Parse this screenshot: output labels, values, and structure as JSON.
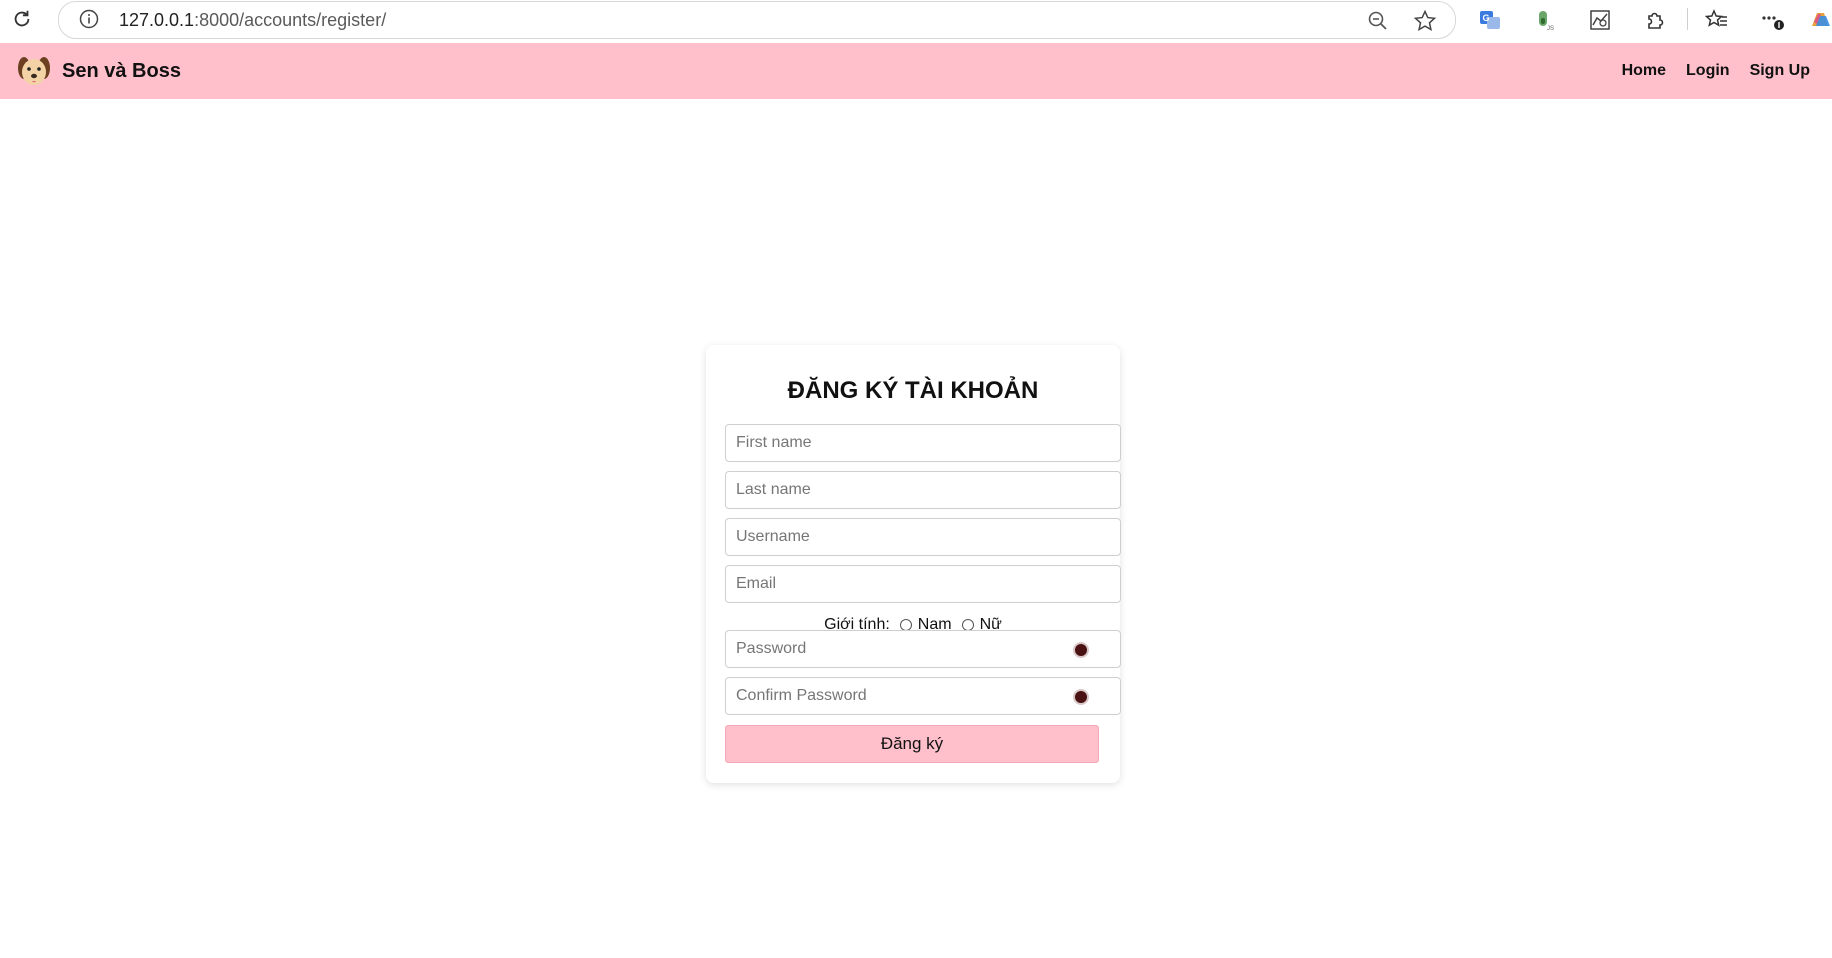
{
  "browser": {
    "url_host": "127.0.0.1",
    "url_rest": ":8000/accounts/register/"
  },
  "navbar": {
    "brand": "Sen và Boss",
    "links": [
      "Home",
      "Login",
      "Sign Up"
    ],
    "background": "#ffc0cb"
  },
  "form": {
    "title": "ĐĂNG KÝ TÀI KHOẢN",
    "first_name_placeholder": "First name",
    "last_name_placeholder": "Last name",
    "username_placeholder": "Username",
    "email_placeholder": "Email",
    "gender_label": "Giới tính:",
    "gender_options": [
      "Nam",
      "Nữ"
    ],
    "password_placeholder": "Password",
    "confirm_password_placeholder": "Confirm Password",
    "submit_label": "Đăng ký"
  },
  "icons": {
    "reload": "reload-icon",
    "site_info": "info-icon",
    "zoom": "zoom-out-icon",
    "favorite": "star-icon",
    "logo": "dog-logo-icon",
    "show_password": "eye-icon"
  }
}
